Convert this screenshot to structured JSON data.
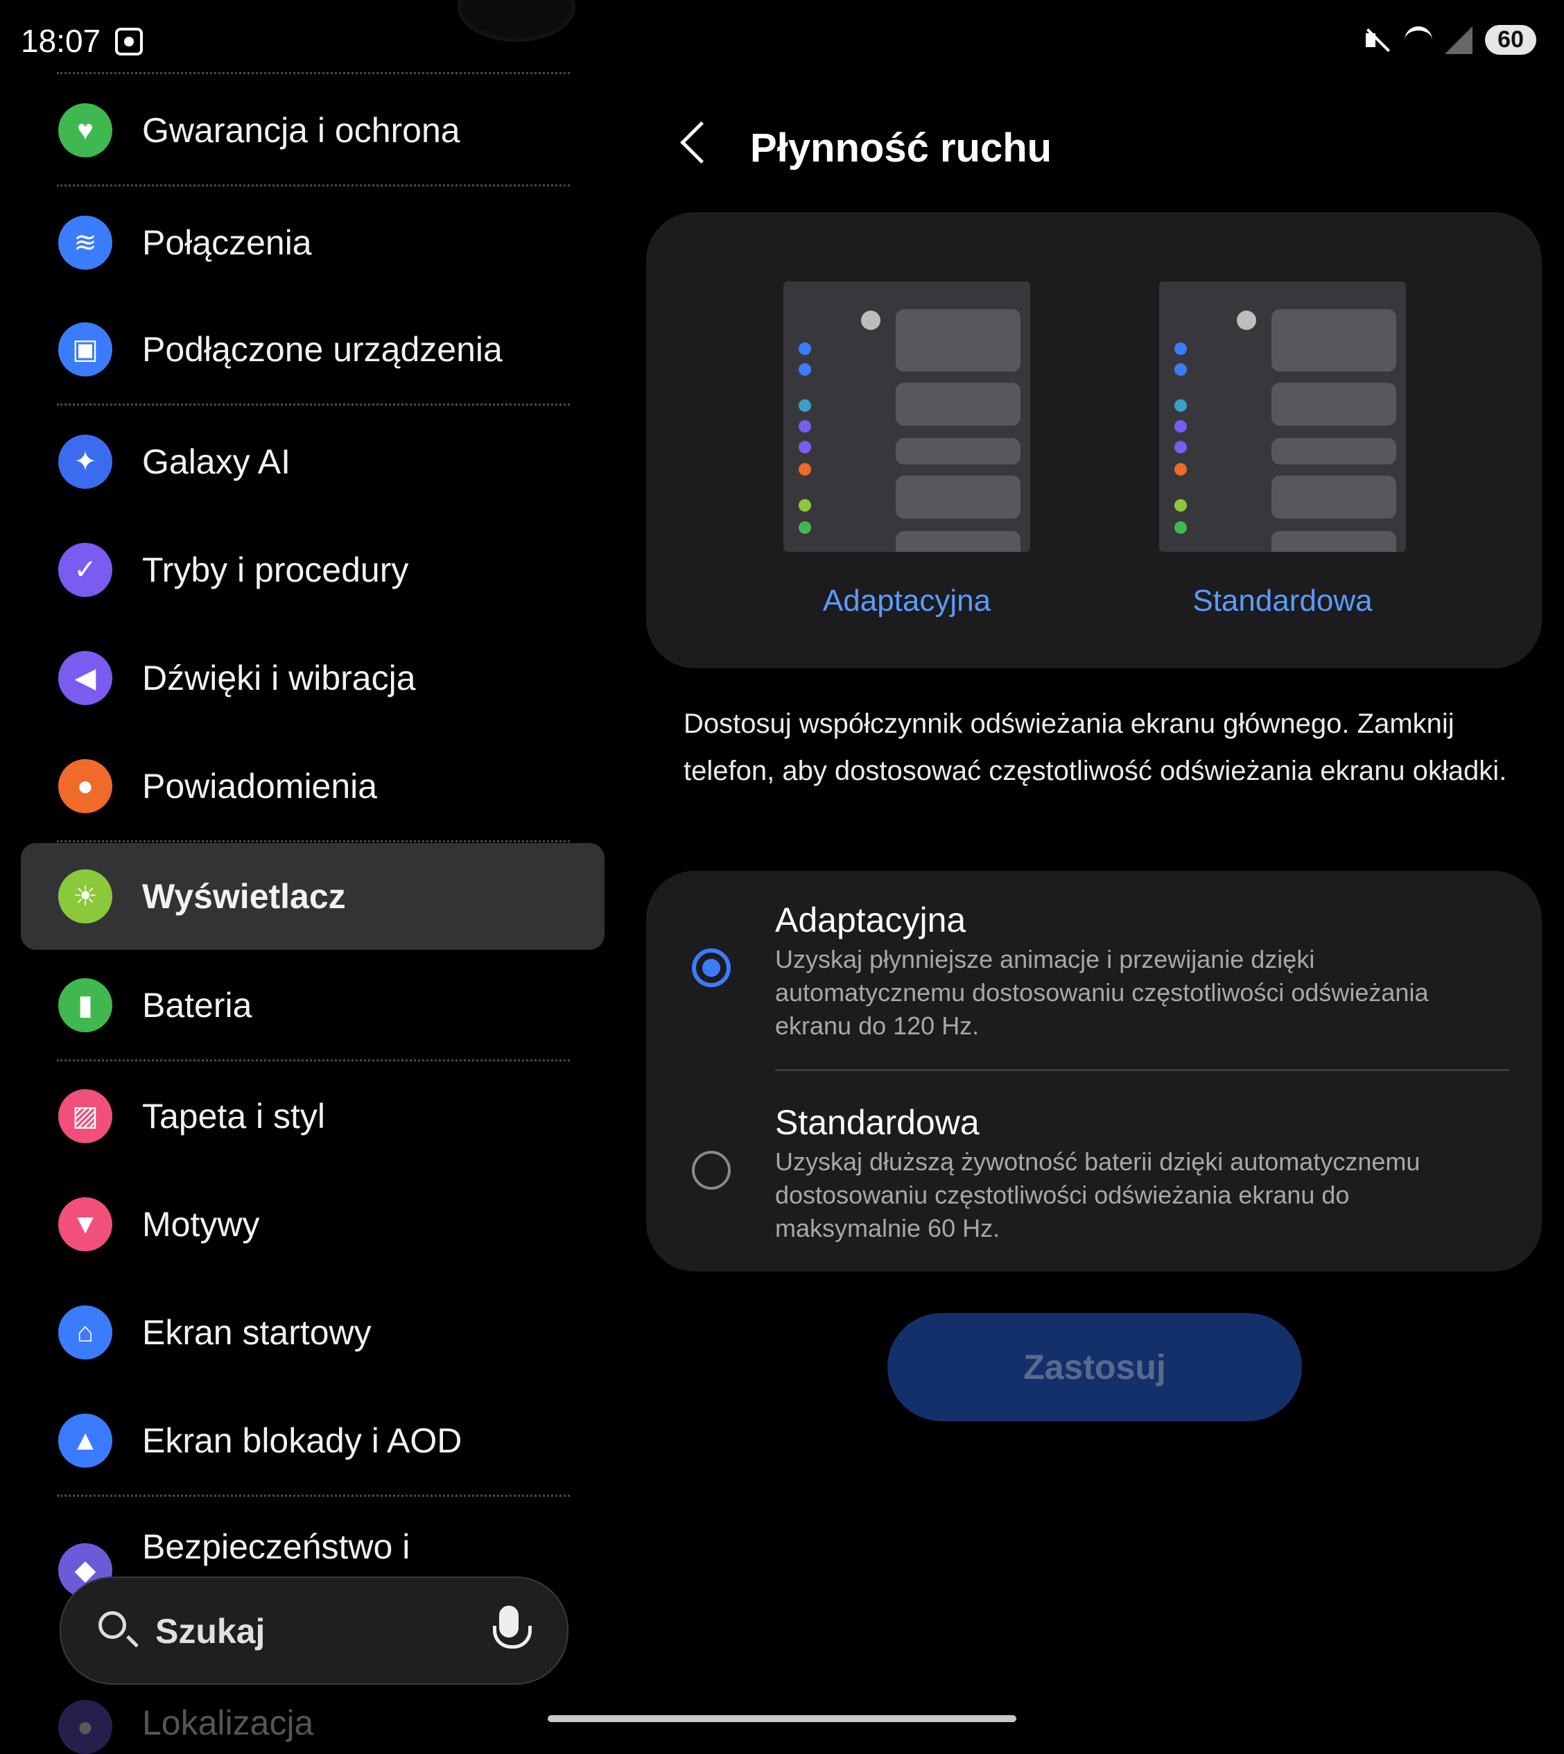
{
  "status_bar": {
    "time": "18:07",
    "battery": "60"
  },
  "sidebar": {
    "items": [
      {
        "label": "Gwarancja i ochrona",
        "icon": "heart-shield-icon",
        "color": "#3fb94f"
      },
      {
        "label": "Połączenia",
        "icon": "wifi-icon",
        "color": "#3b7cff"
      },
      {
        "label": "Podłączone urządzenia",
        "icon": "devices-icon",
        "color": "#3b7cff"
      },
      {
        "label": "Galaxy AI",
        "icon": "sparkle-icon",
        "color": "#3b6cf0"
      },
      {
        "label": "Tryby i procedury",
        "icon": "check-circle-icon",
        "color": "#7a5cf0"
      },
      {
        "label": "Dźwięki i wibracja",
        "icon": "speaker-icon",
        "color": "#7a5cf0"
      },
      {
        "label": "Powiadomienia",
        "icon": "bell-icon",
        "color": "#f06a2a"
      },
      {
        "label": "Wyświetlacz",
        "icon": "sun-icon",
        "color": "#8bc93a"
      },
      {
        "label": "Bateria",
        "icon": "battery-icon",
        "color": "#3fb94f"
      },
      {
        "label": "Tapeta i styl",
        "icon": "image-icon",
        "color": "#f0507a"
      },
      {
        "label": "Motywy",
        "icon": "brush-icon",
        "color": "#f0507a"
      },
      {
        "label": "Ekran startowy",
        "icon": "home-icon",
        "color": "#3b7cff"
      },
      {
        "label": "Ekran blokady i AOD",
        "icon": "lock-icon",
        "color": "#3b7cff"
      },
      {
        "label": "Bezpieczeństwo i",
        "icon": "shield-icon",
        "color": "#6a5cd8"
      },
      {
        "label": "Lokalizacja",
        "icon": "location-icon",
        "color": "#6a5cd8"
      }
    ],
    "search_placeholder": "Szukaj"
  },
  "main": {
    "title": "Płynność ruchu",
    "previews": [
      {
        "label": "Adaptacyjna"
      },
      {
        "label": "Standardowa"
      }
    ],
    "description": "Dostosuj współczynnik odświeżania ekranu głównego. Zamknij telefon, aby dostosować częstotliwość odświeżania ekranu okładki.",
    "options": [
      {
        "title": "Adaptacyjna",
        "desc": "Uzyskaj płynniejsze animacje i przewijanie dzięki automatycznemu dostosowaniu częstotliwości odświeżania ekranu do 120 Hz.",
        "selected": true
      },
      {
        "title": "Standardowa",
        "desc": "Uzyskaj dłuższą żywotność baterii dzięki automatycznemu dostosowaniu częstotliwości odświeżania ekranu do maksymalnie 60 Hz.",
        "selected": false
      }
    ],
    "apply_label": "Zastosuj"
  },
  "colors": {
    "accent": "#3b7cff",
    "link": "#5b9bff",
    "apply_bg": "#14306a"
  }
}
